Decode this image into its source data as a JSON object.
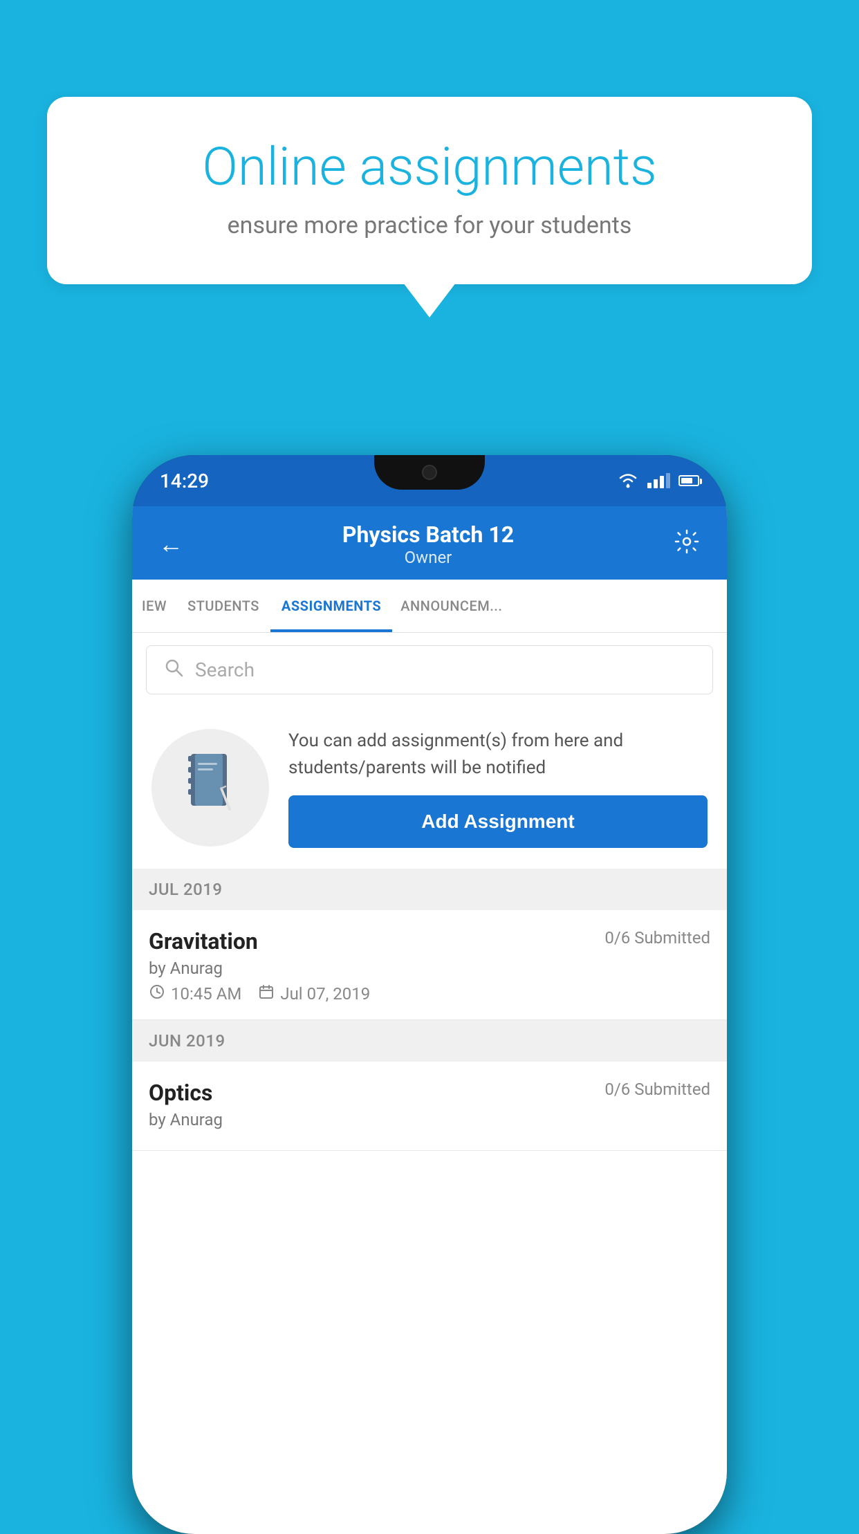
{
  "background_color": "#1ab3e0",
  "speech_bubble": {
    "title": "Online assignments",
    "subtitle": "ensure more practice for your students"
  },
  "phone": {
    "status_bar": {
      "time": "14:29"
    },
    "header": {
      "title": "Physics Batch 12",
      "subtitle": "Owner",
      "back_label": "←",
      "settings_label": "⚙"
    },
    "tabs": [
      {
        "label": "IEW",
        "active": false
      },
      {
        "label": "STUDENTS",
        "active": false
      },
      {
        "label": "ASSIGNMENTS",
        "active": true
      },
      {
        "label": "ANNOUNCEM...",
        "active": false
      }
    ],
    "search": {
      "placeholder": "Search"
    },
    "promo": {
      "description": "You can add assignment(s) from here and students/parents will be notified",
      "button_label": "Add Assignment"
    },
    "sections": [
      {
        "label": "JUL 2019",
        "assignments": [
          {
            "name": "Gravitation",
            "submitted": "0/6 Submitted",
            "by": "by Anurag",
            "time": "10:45 AM",
            "date": "Jul 07, 2019"
          }
        ]
      },
      {
        "label": "JUN 2019",
        "assignments": [
          {
            "name": "Optics",
            "submitted": "0/6 Submitted",
            "by": "by Anurag",
            "time": "",
            "date": ""
          }
        ]
      }
    ]
  }
}
